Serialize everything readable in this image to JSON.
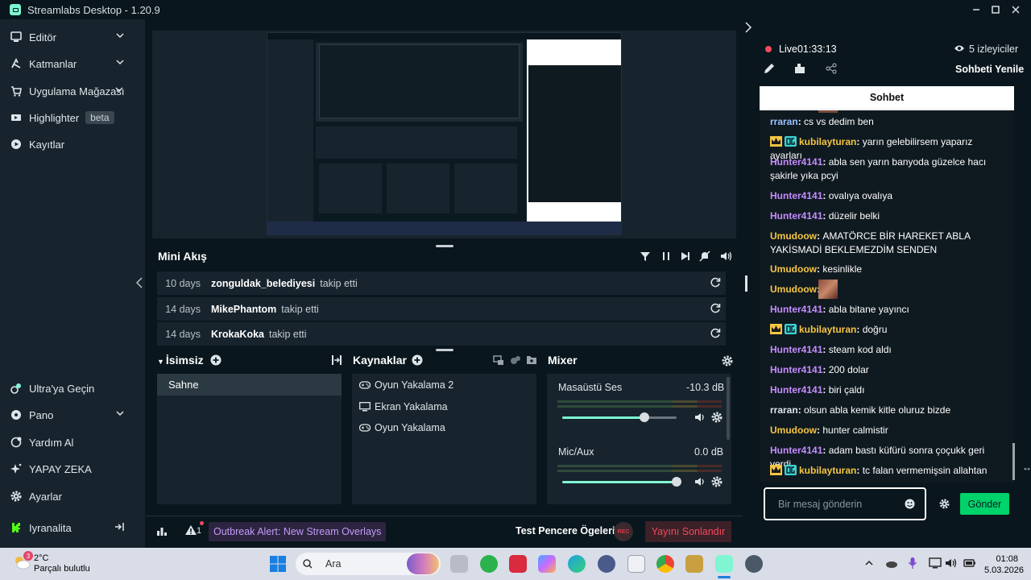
{
  "window": {
    "title": "Streamlabs Desktop - 1.20.9"
  },
  "sidebar": {
    "top_items": [
      {
        "label": "Editör",
        "icon": "editor-icon"
      },
      {
        "label": "Katmanlar",
        "icon": "layers-icon"
      },
      {
        "label": "Uygulama Mağazası",
        "icon": "store-icon"
      },
      {
        "label": "Highlighter",
        "icon": "highlighter-icon",
        "badge": "beta"
      },
      {
        "label": "Kayıtlar",
        "icon": "recordings-icon"
      }
    ],
    "bottom_items": [
      {
        "label": "Ultra'ya Geçin",
        "icon": "ultra-icon"
      },
      {
        "label": "Pano",
        "icon": "dashboard-icon"
      },
      {
        "label": "Yardım Al",
        "icon": "help-icon"
      },
      {
        "label": "YAPAY ZEKA",
        "icon": "ai-icon"
      },
      {
        "label": "Ayarlar",
        "icon": "settings-icon"
      },
      {
        "label": "Iyranalita",
        "icon": "kick-icon"
      }
    ]
  },
  "mini_feed": {
    "title": "Mini Akış",
    "rows": [
      {
        "time": "10 days",
        "user": "zonguldak_belediyesi",
        "action": "takip etti"
      },
      {
        "time": "14 days",
        "user": "MikePhantom",
        "action": "takip etti"
      },
      {
        "time": "14 days",
        "user": "KrokaKoka",
        "action": "takip etti"
      }
    ]
  },
  "scenes": {
    "title": "İsimsiz",
    "items": [
      "Sahne"
    ]
  },
  "sources": {
    "title": "Kaynaklar",
    "items": [
      "Oyun Yakalama 2",
      "Ekran Yakalama",
      "Oyun Yakalama"
    ]
  },
  "mixer": {
    "title": "Mixer",
    "channels": [
      {
        "name": "Masaüstü Ses",
        "db": "-10.3 dB",
        "level": 0.72
      },
      {
        "name": "Mic/Aux",
        "db": "0.0 dB",
        "level": 1.0
      }
    ]
  },
  "footer": {
    "alert": "Outbreak Alert: New Stream Overlays",
    "alert_count": "1",
    "test_items": "Test Pencere Ögeleri",
    "rec": "REC",
    "end_stream": "Yayını Sonlandır"
  },
  "live": {
    "label": "Live",
    "timer": "01:33:13",
    "viewers": "5 izleyiciler",
    "refresh": "Sohbeti Yenile"
  },
  "chat": {
    "title": "Sohbet",
    "input_placeholder": "Bir mesaj gönderin",
    "send": "Gönder",
    "messages": [
      {
        "user": "rraran",
        "text": "cs vs dedim ben",
        "color": "#9ac4ff",
        "badges": false
      },
      {
        "user": "kubilayturan",
        "text": "yarın gelebilirsem yaparız ayarları",
        "color": "#f5c542",
        "badges": true
      },
      {
        "user": "Hunter4141",
        "text": "abla sen yarın banyoda güzelce hacı şakirle yıka pcyi",
        "color": "#c58cff",
        "badges": false
      },
      {
        "user": "Hunter4141",
        "text": "ovalıya ovalıya",
        "color": "#c58cff",
        "badges": false
      },
      {
        "user": "Hunter4141",
        "text": "düzelir belki",
        "color": "#c58cff",
        "badges": false
      },
      {
        "user": "Umudoow",
        "text": "AMATÖRCE BİR HAREKET ABLA YAKİSMADİ BEKLEMEZDİM SENDEN",
        "color": "#f5c542",
        "badges": false
      },
      {
        "user": "Umudoow",
        "text": "kesinlikle",
        "color": "#f5c542",
        "badges": false
      },
      {
        "user": "Umudoow",
        "text": "",
        "color": "#f5c542",
        "badges": false,
        "emote": true
      },
      {
        "user": "Hunter4141",
        "text": "abla bitane yayıncı",
        "color": "#c58cff",
        "badges": false
      },
      {
        "user": "kubilayturan",
        "text": "doğru",
        "color": "#f5c542",
        "badges": true
      },
      {
        "user": "Hunter4141",
        "text": "steam kod aldı",
        "color": "#c58cff",
        "badges": false
      },
      {
        "user": "Hunter4141",
        "text": "200 dolar",
        "color": "#c58cff",
        "badges": false
      },
      {
        "user": "Hunter4141",
        "text": "biri çaldı",
        "color": "#c58cff",
        "badges": false
      },
      {
        "user": "rraran",
        "text": "olsun abla kemik kitle oluruz bizde",
        "color": "#9ac4ff",
        "badges": false
      },
      {
        "user": "Umudoow",
        "text": "hunter calmistir",
        "color": "#f5c542",
        "badges": false
      },
      {
        "user": "Hunter4141",
        "text": "adam bastı küfürü sonra çoçukk geri verdi",
        "color": "#c58cff",
        "badges": false
      },
      {
        "user": "kubilayturan",
        "text": "tc falan vermemişsin allahtan",
        "color": "#f5c542",
        "badges": true
      }
    ]
  },
  "taskbar": {
    "weather_temp": "2°C",
    "weather_desc": "Parçalı bulutlu",
    "weather_badge": "3",
    "search_placeholder": "Ara",
    "time": "01:08",
    "date": "5.03.2026"
  },
  "colors": {
    "accent": "#80f5d2",
    "panel": "#17242d",
    "background": "#09161d",
    "live": "#f04a5b",
    "send": "#00d36a"
  }
}
